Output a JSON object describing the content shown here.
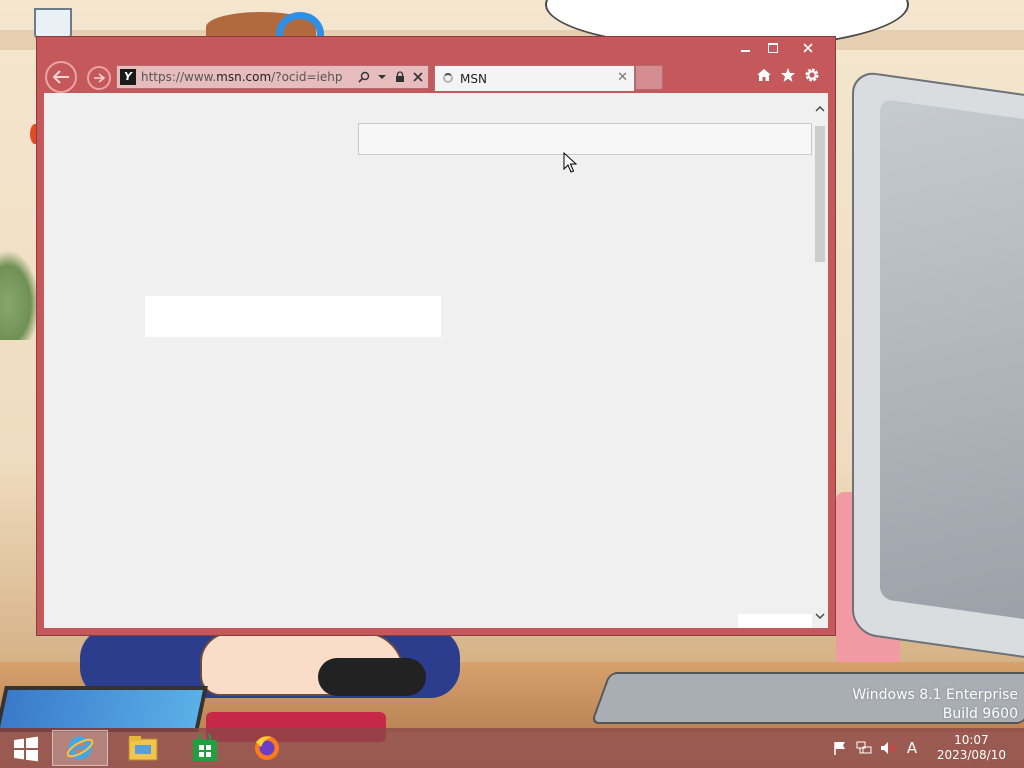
{
  "desktop": {
    "watermark": {
      "line1": "Windows 8.1 Enterprise",
      "line2": "Build 9600"
    }
  },
  "browser": {
    "address_bar": {
      "url_prefix": "https://www.",
      "url_domain": "msn.com",
      "url_path": "/?ocid=iehp",
      "site_icon": "Y"
    },
    "tabs": [
      {
        "title": "MSN",
        "state": "loading"
      }
    ],
    "toolbar_icons": [
      "home-icon",
      "favorites-star-icon",
      "settings-gear-icon"
    ],
    "nav_icons": [
      "back-arrow-icon",
      "forward-arrow-icon"
    ],
    "address_icons": [
      "search-icon",
      "dropdown-icon",
      "lock-icon",
      "stop-icon"
    ],
    "colors": {
      "frame": "#c4585a",
      "content_bg": "#f0f0f0",
      "address_bg": "#e7bcbd"
    }
  },
  "taskbar": {
    "apps": [
      {
        "name": "internet-explorer",
        "active": true
      },
      {
        "name": "file-explorer",
        "active": false
      },
      {
        "name": "store",
        "active": false
      },
      {
        "name": "firefox",
        "active": false
      }
    ],
    "tray": {
      "ime_label": "A",
      "time": "10:07",
      "date": "2023/08/10"
    }
  }
}
